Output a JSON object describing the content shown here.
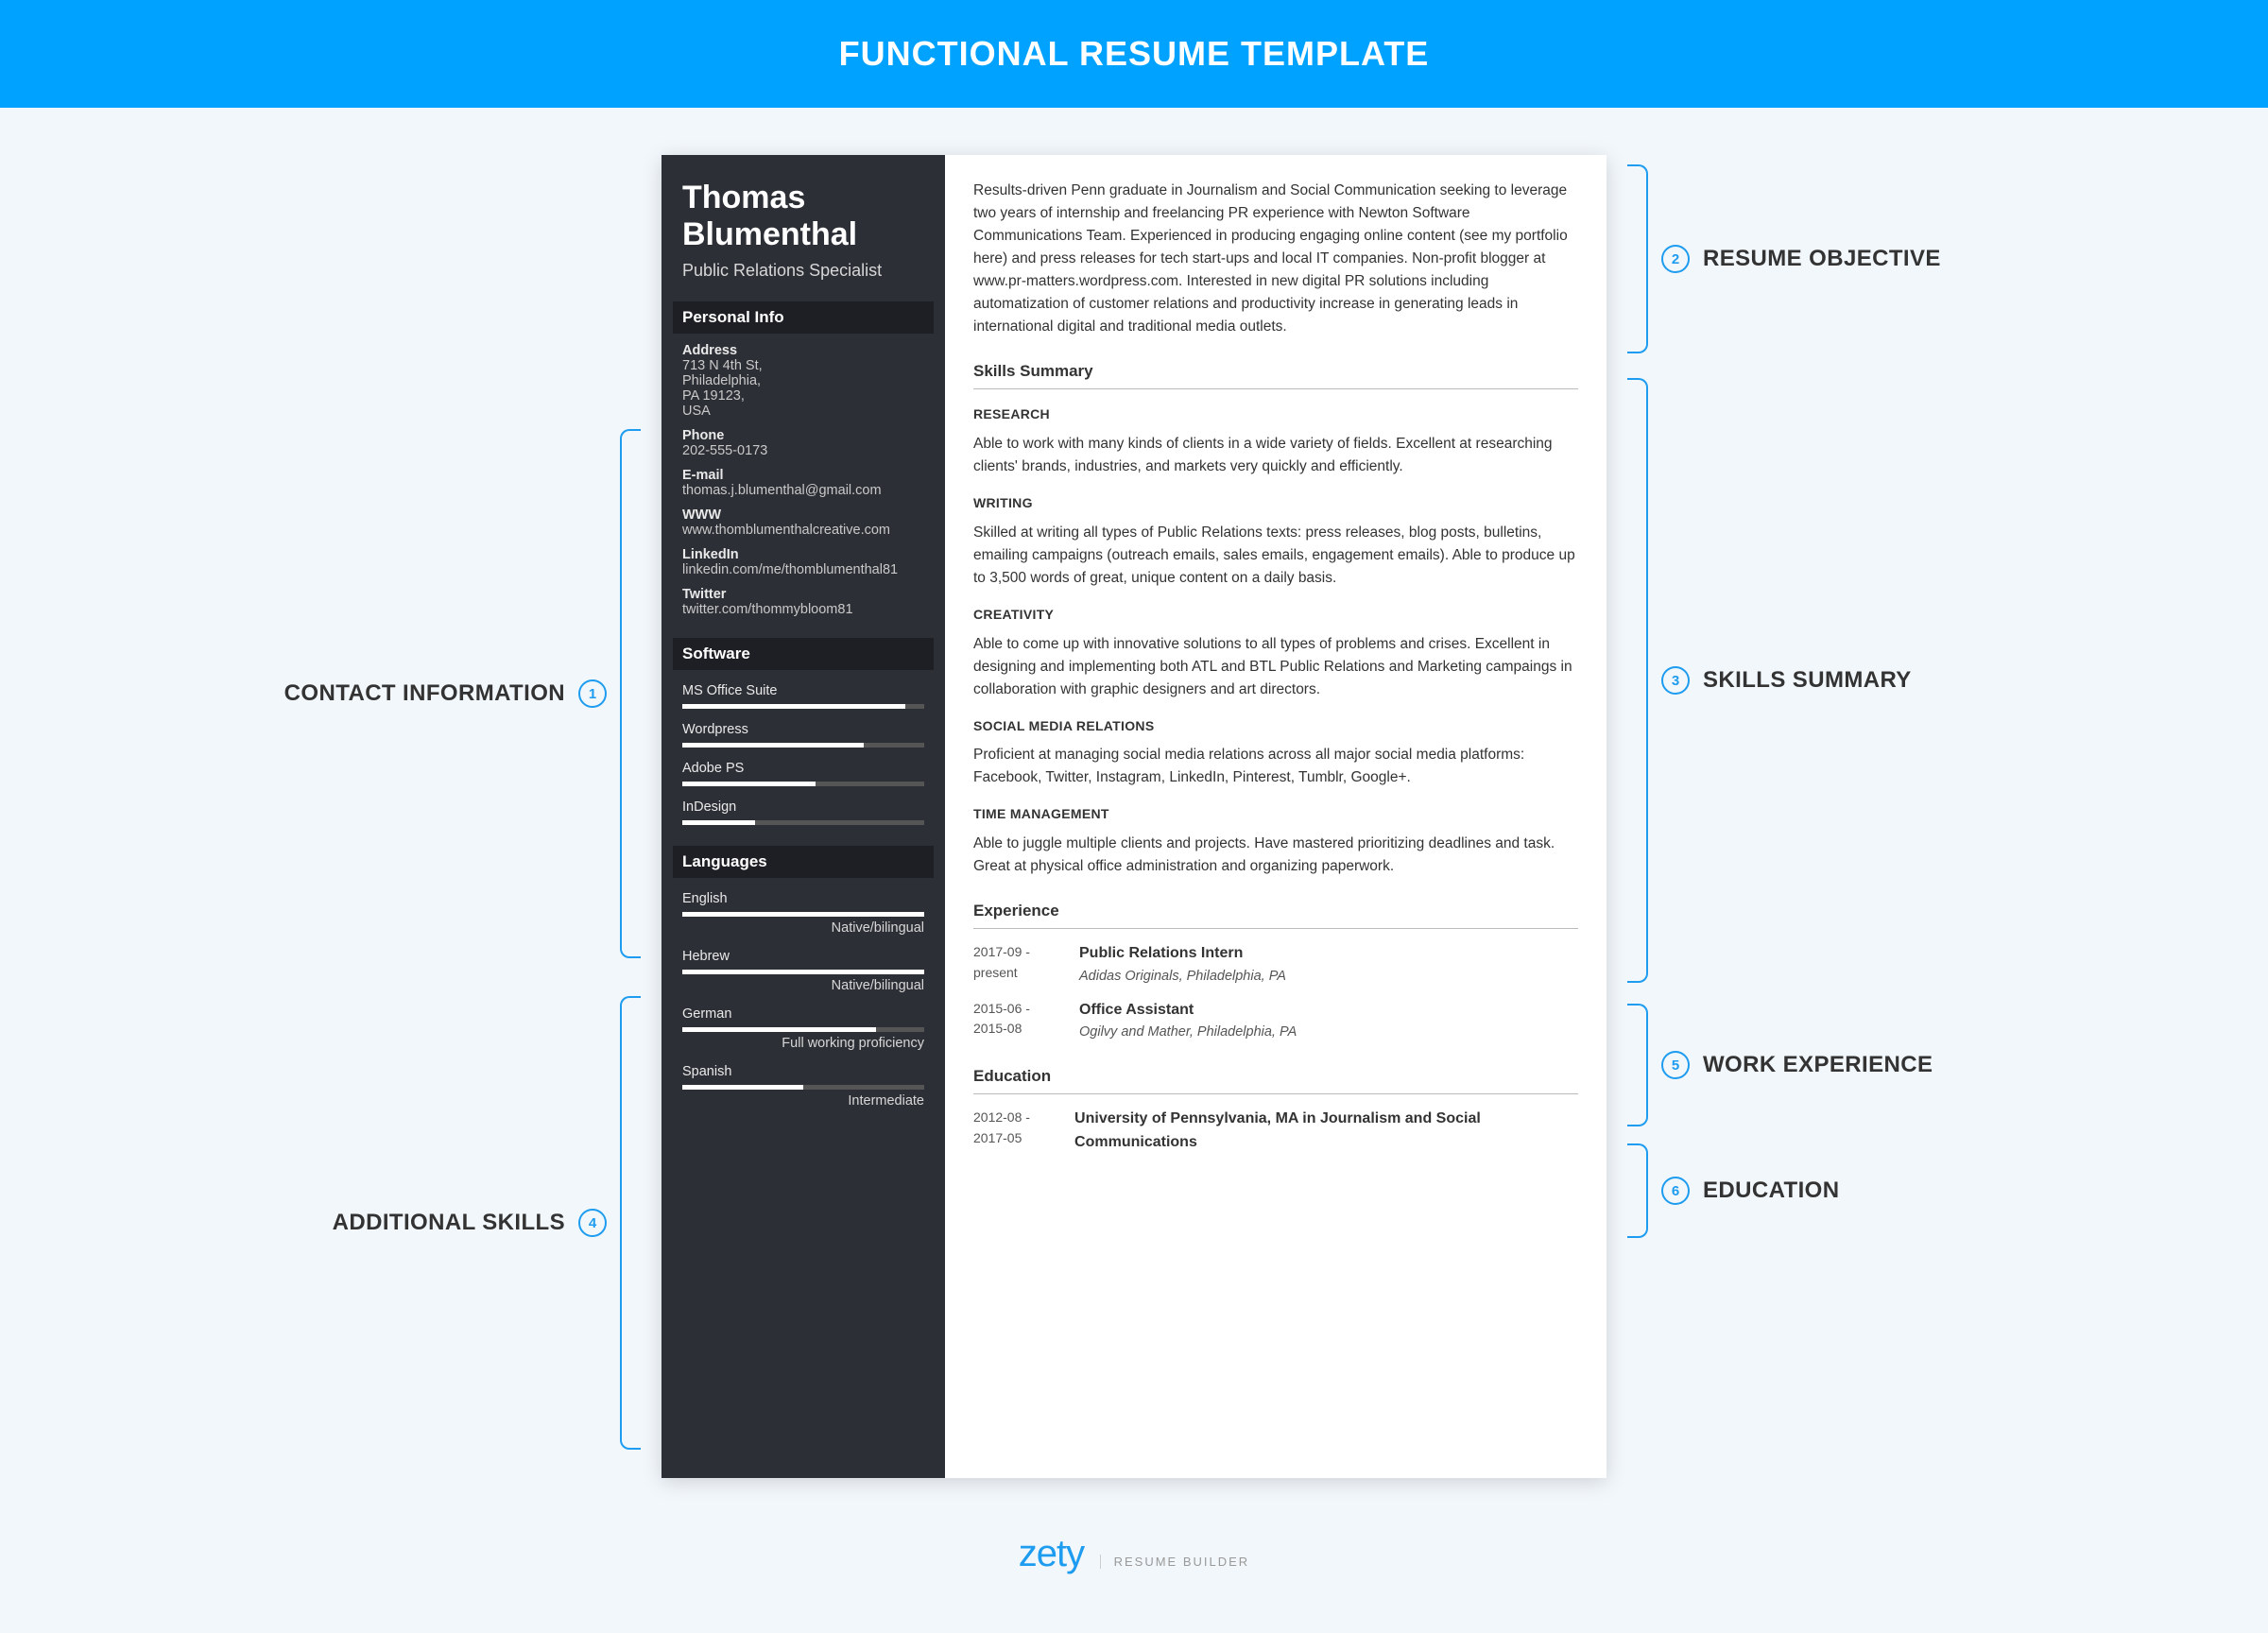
{
  "banner": "FUNCTIONAL RESUME TEMPLATE",
  "annotations": {
    "left": [
      {
        "n": "1",
        "label": "CONTACT INFORMATION"
      },
      {
        "n": "4",
        "label": "ADDITIONAL SKILLS"
      }
    ],
    "right": [
      {
        "n": "2",
        "label": "RESUME OBJECTIVE"
      },
      {
        "n": "3",
        "label": "SKILLS SUMMARY"
      },
      {
        "n": "5",
        "label": "WORK EXPERIENCE"
      },
      {
        "n": "6",
        "label": "EDUCATION"
      }
    ]
  },
  "resume": {
    "name": "Thomas Blumenthal",
    "title": "Public Relations Specialist",
    "sections": {
      "personal_info_h": "Personal Info",
      "software_h": "Software",
      "languages_h": "Languages"
    },
    "contact": {
      "address_l": "Address",
      "address_v": "713 N 4th St,\nPhiladelphia,\nPA 19123,\nUSA",
      "phone_l": "Phone",
      "phone_v": "202-555-0173",
      "email_l": "E-mail",
      "email_v": "thomas.j.blumenthal@gmail.com",
      "www_l": "WWW",
      "www_v": "www.thomblumenthalcreative.com",
      "linkedin_l": "LinkedIn",
      "linkedin_v": "linkedin.com/me/thomblumenthal81",
      "twitter_l": "Twitter",
      "twitter_v": "twitter.com/thommybloom81"
    },
    "software": [
      {
        "name": "MS Office Suite",
        "pct": 92
      },
      {
        "name": "Wordpress",
        "pct": 75
      },
      {
        "name": "Adobe PS",
        "pct": 55
      },
      {
        "name": "InDesign",
        "pct": 30
      }
    ],
    "languages": [
      {
        "name": "English",
        "pct": 100,
        "level": "Native/bilingual"
      },
      {
        "name": "Hebrew",
        "pct": 100,
        "level": "Native/bilingual"
      },
      {
        "name": "German",
        "pct": 80,
        "level": "Full working proficiency"
      },
      {
        "name": "Spanish",
        "pct": 50,
        "level": "Intermediate"
      }
    ],
    "objective": "Results-driven Penn graduate in Journalism and Social Communication seeking to leverage two years of internship and freelancing PR experience with Newton Software Communications Team. Experienced in producing engaging online content (see my portfolio here) and press releases for tech start-ups and local IT companies. Non-profit blogger at www.pr-matters.wordpress.com. Interested in new digital PR solutions including automatization of customer relations and productivity increase in generating leads in international digital and traditional media outlets.",
    "skills_h": "Skills Summary",
    "skills": [
      {
        "h": "RESEARCH",
        "t": "Able to work with many kinds of clients in a wide variety of fields. Excellent at researching clients' brands, industries, and markets very quickly and efficiently."
      },
      {
        "h": "WRITING",
        "t": "Skilled at writing all types of Public Relations texts: press releases, blog posts, bulletins, emailing campaigns (outreach emails, sales emails, engagement emails). Able to produce up to 3,500 words of great, unique content on a daily basis."
      },
      {
        "h": "CREATIVITY",
        "t": "Able to come up with innovative solutions to all types of problems and crises. Excellent in designing and implementing both ATL and BTL Public Relations and Marketing campaings in collaboration with graphic designers and art directors."
      },
      {
        "h": "SOCIAL MEDIA RELATIONS",
        "t": "Proficient at managing social media relations across all major social media platforms: Facebook, Twitter, Instagram, LinkedIn, Pinterest, Tumblr, Google+."
      },
      {
        "h": "TIME MANAGEMENT",
        "t": "Able to juggle multiple clients and projects. Have mastered prioritizing deadlines and task. Great at physical office administration and organizing paperwork."
      }
    ],
    "exp_h": "Experience",
    "experience": [
      {
        "date": "2017-09 - present",
        "role": "Public Relations Intern",
        "org": "Adidas Originals, Philadelphia, PA"
      },
      {
        "date": "2015-06 - 2015-08",
        "role": "Office Assistant",
        "org": "Ogilvy and Mather, Philadelphia, PA"
      }
    ],
    "edu_h": "Education",
    "education": [
      {
        "date": "2012-08 - 2017-05",
        "role": "University of Pennsylvania, MA in Journalism and Social Communications",
        "org": ""
      }
    ]
  },
  "footer": {
    "brand": "zety",
    "sub": "RESUME BUILDER"
  }
}
